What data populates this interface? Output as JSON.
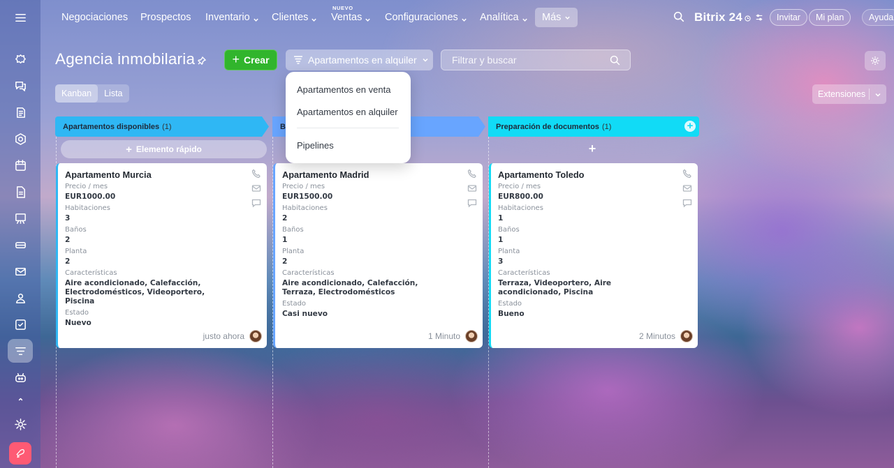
{
  "nav": {
    "items": [
      {
        "label": "Negociaciones",
        "dropdown": false
      },
      {
        "label": "Prospectos",
        "dropdown": false
      },
      {
        "label": "Inventario",
        "dropdown": true
      },
      {
        "label": "Clientes",
        "dropdown": true
      },
      {
        "label": "Ventas",
        "dropdown": true,
        "badge": "NUEVO"
      },
      {
        "label": "Configuraciones",
        "dropdown": true
      },
      {
        "label": "Analítica",
        "dropdown": true
      }
    ],
    "more_label": "Más",
    "brand": "Bitrix 24",
    "invite": "Invitar",
    "my_plan": "Mi plan",
    "help": "Ayuda"
  },
  "page": {
    "title": "Agencia inmobilaria",
    "create_label": "Crear",
    "pipeline_label": "Apartamentos en alquiler",
    "search_placeholder": "Filtrar y buscar",
    "views": [
      "Kanban",
      "Lista"
    ],
    "extensions_label": "Extensiones"
  },
  "dropdown": {
    "items": [
      "Apartamentos en venta",
      "Apartamentos en alquiler"
    ],
    "footer": "Pipelines"
  },
  "columns": [
    {
      "title": "Apartamentos disponibles",
      "count": "(1)",
      "color": "#2fb7f4",
      "quick_add": "Elemento rápido"
    },
    {
      "title": "B",
      "count": "",
      "color": "#68a5ff"
    },
    {
      "title": "Preparación de documentos",
      "count": "(1)",
      "color": "#11dbf6"
    }
  ],
  "labels": {
    "price": "Precio / mes",
    "rooms": "Habitaciones",
    "baths": "Baños",
    "floor": "Planta",
    "features": "Características",
    "status": "Estado"
  },
  "cards": [
    {
      "title": "Apartamento Murcia",
      "price": "EUR1000.00",
      "rooms": "3",
      "baths": "2",
      "floor": "2",
      "features": "Aire acondicionado, Calefacción, Electrodomésticos, Videoportero, Piscina",
      "status": "Nuevo",
      "time": "justo ahora",
      "accent": "#2fb7f4"
    },
    {
      "title": "Apartamento Madrid",
      "price": "EUR1500.00",
      "rooms": "2",
      "baths": "1",
      "floor": "2",
      "features": "Aire acondicionado, Calefacción, Terraza, Electrodomésticos",
      "status": "Casi nuevo",
      "time": "1 Minuto",
      "accent": "#68a5ff"
    },
    {
      "title": "Apartamento Toledo",
      "price": "EUR800.00",
      "rooms": "1",
      "baths": "1",
      "floor": "3",
      "features": "Terraza, Videoportero, Aire acondicionado, Piscina",
      "status": "Bueno",
      "time": "2 Minutos",
      "accent": "#11dbf6"
    }
  ]
}
